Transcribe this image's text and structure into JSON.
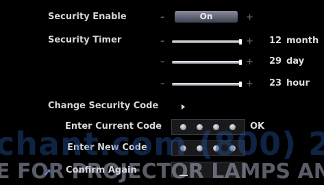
{
  "menu": {
    "security_enable": {
      "label": "Security Enable",
      "minus": "–",
      "value": "On",
      "plus": "+"
    },
    "timers": [
      {
        "label": "Security Timer",
        "minus": "–",
        "plus": "+",
        "value": "12",
        "unit": "month",
        "level": 1.0
      },
      {
        "label": "",
        "minus": "–",
        "plus": "+",
        "value": "29",
        "unit": "day",
        "level": 1.0
      },
      {
        "label": "",
        "minus": "–",
        "plus": "+",
        "value": "23",
        "unit": "hour",
        "level": 1.0
      }
    ],
    "change_code": {
      "label": "Change Security Code",
      "arrow_icon": "triangle-right-icon"
    },
    "enter_current": {
      "label": "Enter Current Code",
      "dots": 4,
      "ok": "OK"
    },
    "enter_new": {
      "label": "Enter New Code",
      "dots": 4
    },
    "confirm": {
      "label": "Confirm Again"
    },
    "corner_icon": "arrow-up-right-icon"
  },
  "watermark": {
    "line1": "chant.com (800) 2",
    "line2": "E FOR PROJECTOR LAMPS AND ACC"
  },
  "colors": {
    "background": "#000000",
    "text": "#d5d6db",
    "toggle": "#6b6d80",
    "watermark_blue": "#214e96",
    "accent_icon": "#4c8fe0"
  }
}
